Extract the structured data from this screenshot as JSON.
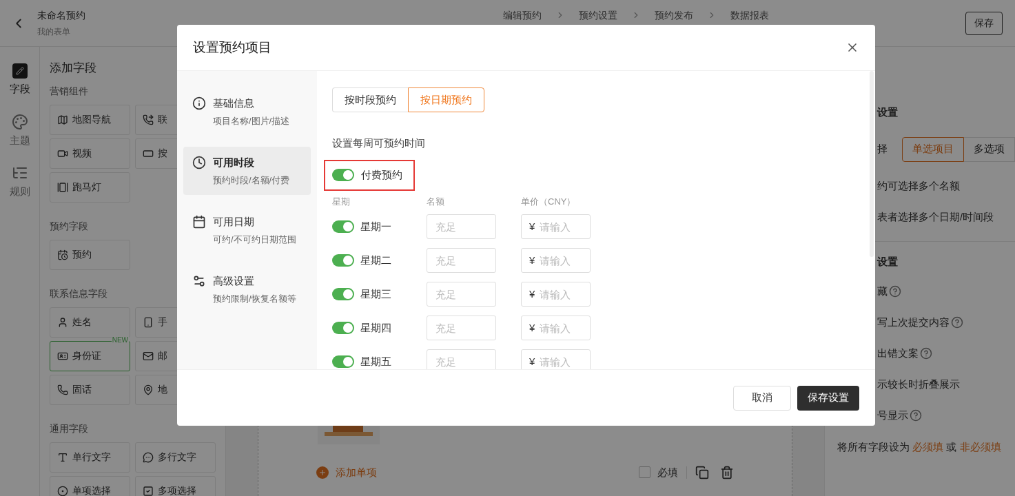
{
  "header": {
    "title": "未命名预约",
    "subtitle": "我的表单",
    "steps": [
      "编辑预约",
      "预约设置",
      "预约发布",
      "数据报表"
    ],
    "save": "保存"
  },
  "nav": [
    {
      "label": "字段",
      "selected": true
    },
    {
      "label": "主题",
      "selected": false
    },
    {
      "label": "规则",
      "selected": false
    }
  ],
  "fields_panel": {
    "title": "添加字段",
    "groups": [
      {
        "title": "营销组件",
        "items": [
          {
            "label": "地图导航"
          },
          {
            "label": "联"
          },
          {
            "label": "视频"
          },
          {
            "label": "按"
          },
          {
            "label": "跑马灯"
          }
        ]
      },
      {
        "title": "预约字段",
        "items": [
          {
            "label": "预约"
          }
        ]
      },
      {
        "title": "联系信息字段",
        "items": [
          {
            "label": "姓名"
          },
          {
            "label": "手"
          },
          {
            "label": "身份证",
            "badge": "NEW"
          },
          {
            "label": "邮"
          },
          {
            "label": "固话"
          },
          {
            "label": "地"
          }
        ]
      },
      {
        "title": "通用字段",
        "items": [
          {
            "label": "单行文字"
          },
          {
            "label": "多行文字"
          },
          {
            "label": "单项选择"
          },
          {
            "label": "多项选择"
          }
        ]
      }
    ]
  },
  "canvas": {
    "add_item": "添加单项",
    "required": {
      "label": "必填",
      "checked": false
    }
  },
  "settings_panel": {
    "heading_1": "设置",
    "mode_label": "择",
    "modes": [
      {
        "label": "单选项目",
        "selected": true
      },
      {
        "label": "多选项",
        "selected": false
      }
    ],
    "lines_1": [
      "约可选择多个名额",
      "表者选择多个日期/时间段"
    ],
    "heading_2": "设置",
    "lines_2": [
      {
        "text": "藏",
        "help": true
      },
      {
        "text": "写上次提交内容",
        "help": true
      },
      {
        "text": "出错文案",
        "help": true
      },
      {
        "text": "示较长时折叠展示",
        "help": false
      },
      {
        "text": "号显示",
        "help": true
      }
    ],
    "footer_text": "将所有字段设为",
    "footer_link_1": "必须填",
    "footer_or": "或",
    "footer_link_2": "非必须填"
  },
  "dialog": {
    "title": "设置预约项目",
    "menu": [
      {
        "title": "基础信息",
        "subtitle": "项目名称/图片/描述",
        "selected": false
      },
      {
        "title": "可用时段",
        "subtitle": "预约时段/名额/付费",
        "selected": true
      },
      {
        "title": "可用日期",
        "subtitle": "可约/不可约日期范围",
        "selected": false
      },
      {
        "title": "高级设置",
        "subtitle": "预约限制/恢复名额等",
        "selected": false
      }
    ],
    "tabs": [
      {
        "label": "按时段预约",
        "selected": false
      },
      {
        "label": "按日期预约",
        "selected": true
      }
    ],
    "section_title": "设置每周可预约时间",
    "paid": {
      "label": "付费预约",
      "on": true
    },
    "columns": [
      "星期",
      "名额",
      "单价（CNY）"
    ],
    "rows": [
      {
        "day": "星期一",
        "on": true,
        "quota_placeholder": "充足",
        "currency": "¥",
        "price_placeholder": "请输入"
      },
      {
        "day": "星期二",
        "on": true,
        "quota_placeholder": "充足",
        "currency": "¥",
        "price_placeholder": "请输入"
      },
      {
        "day": "星期三",
        "on": true,
        "quota_placeholder": "充足",
        "currency": "¥",
        "price_placeholder": "请输入"
      },
      {
        "day": "星期四",
        "on": true,
        "quota_placeholder": "充足",
        "currency": "¥",
        "price_placeholder": "请输入"
      },
      {
        "day": "星期五",
        "on": true,
        "quota_placeholder": "充足",
        "currency": "¥",
        "price_placeholder": "请输入"
      }
    ],
    "cancel": "取消",
    "save": "保存设置"
  }
}
